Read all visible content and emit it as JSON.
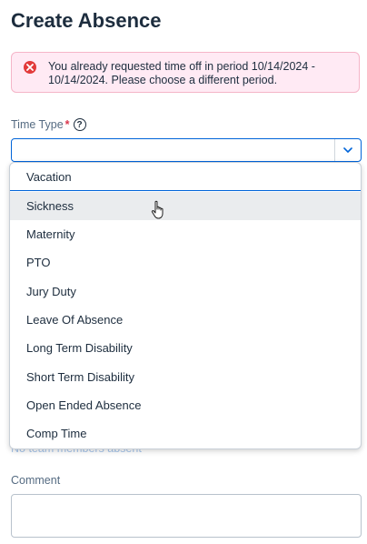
{
  "page": {
    "title": "Create Absence"
  },
  "error": {
    "icon": "error-x-icon",
    "message": "You already requested time off in period 10/14/2024 - 10/14/2024. Please choose a different period.",
    "color": "#e23a3a"
  },
  "time_type": {
    "label": "Time Type",
    "required_marker": "*",
    "help_glyph": "?",
    "value": "",
    "options": [
      "Vacation",
      "Sickness",
      "Maternity",
      "PTO",
      "Jury Duty",
      "Leave Of Absence",
      "Long Term Disability",
      "Short Term Disability",
      "Open Ended Absence",
      "Comp Time"
    ],
    "hovered_option": "Sickness",
    "accent_color": "#0064d9"
  },
  "team": {
    "absent_text": "No team members absent"
  },
  "comment": {
    "label": "Comment",
    "value": ""
  }
}
